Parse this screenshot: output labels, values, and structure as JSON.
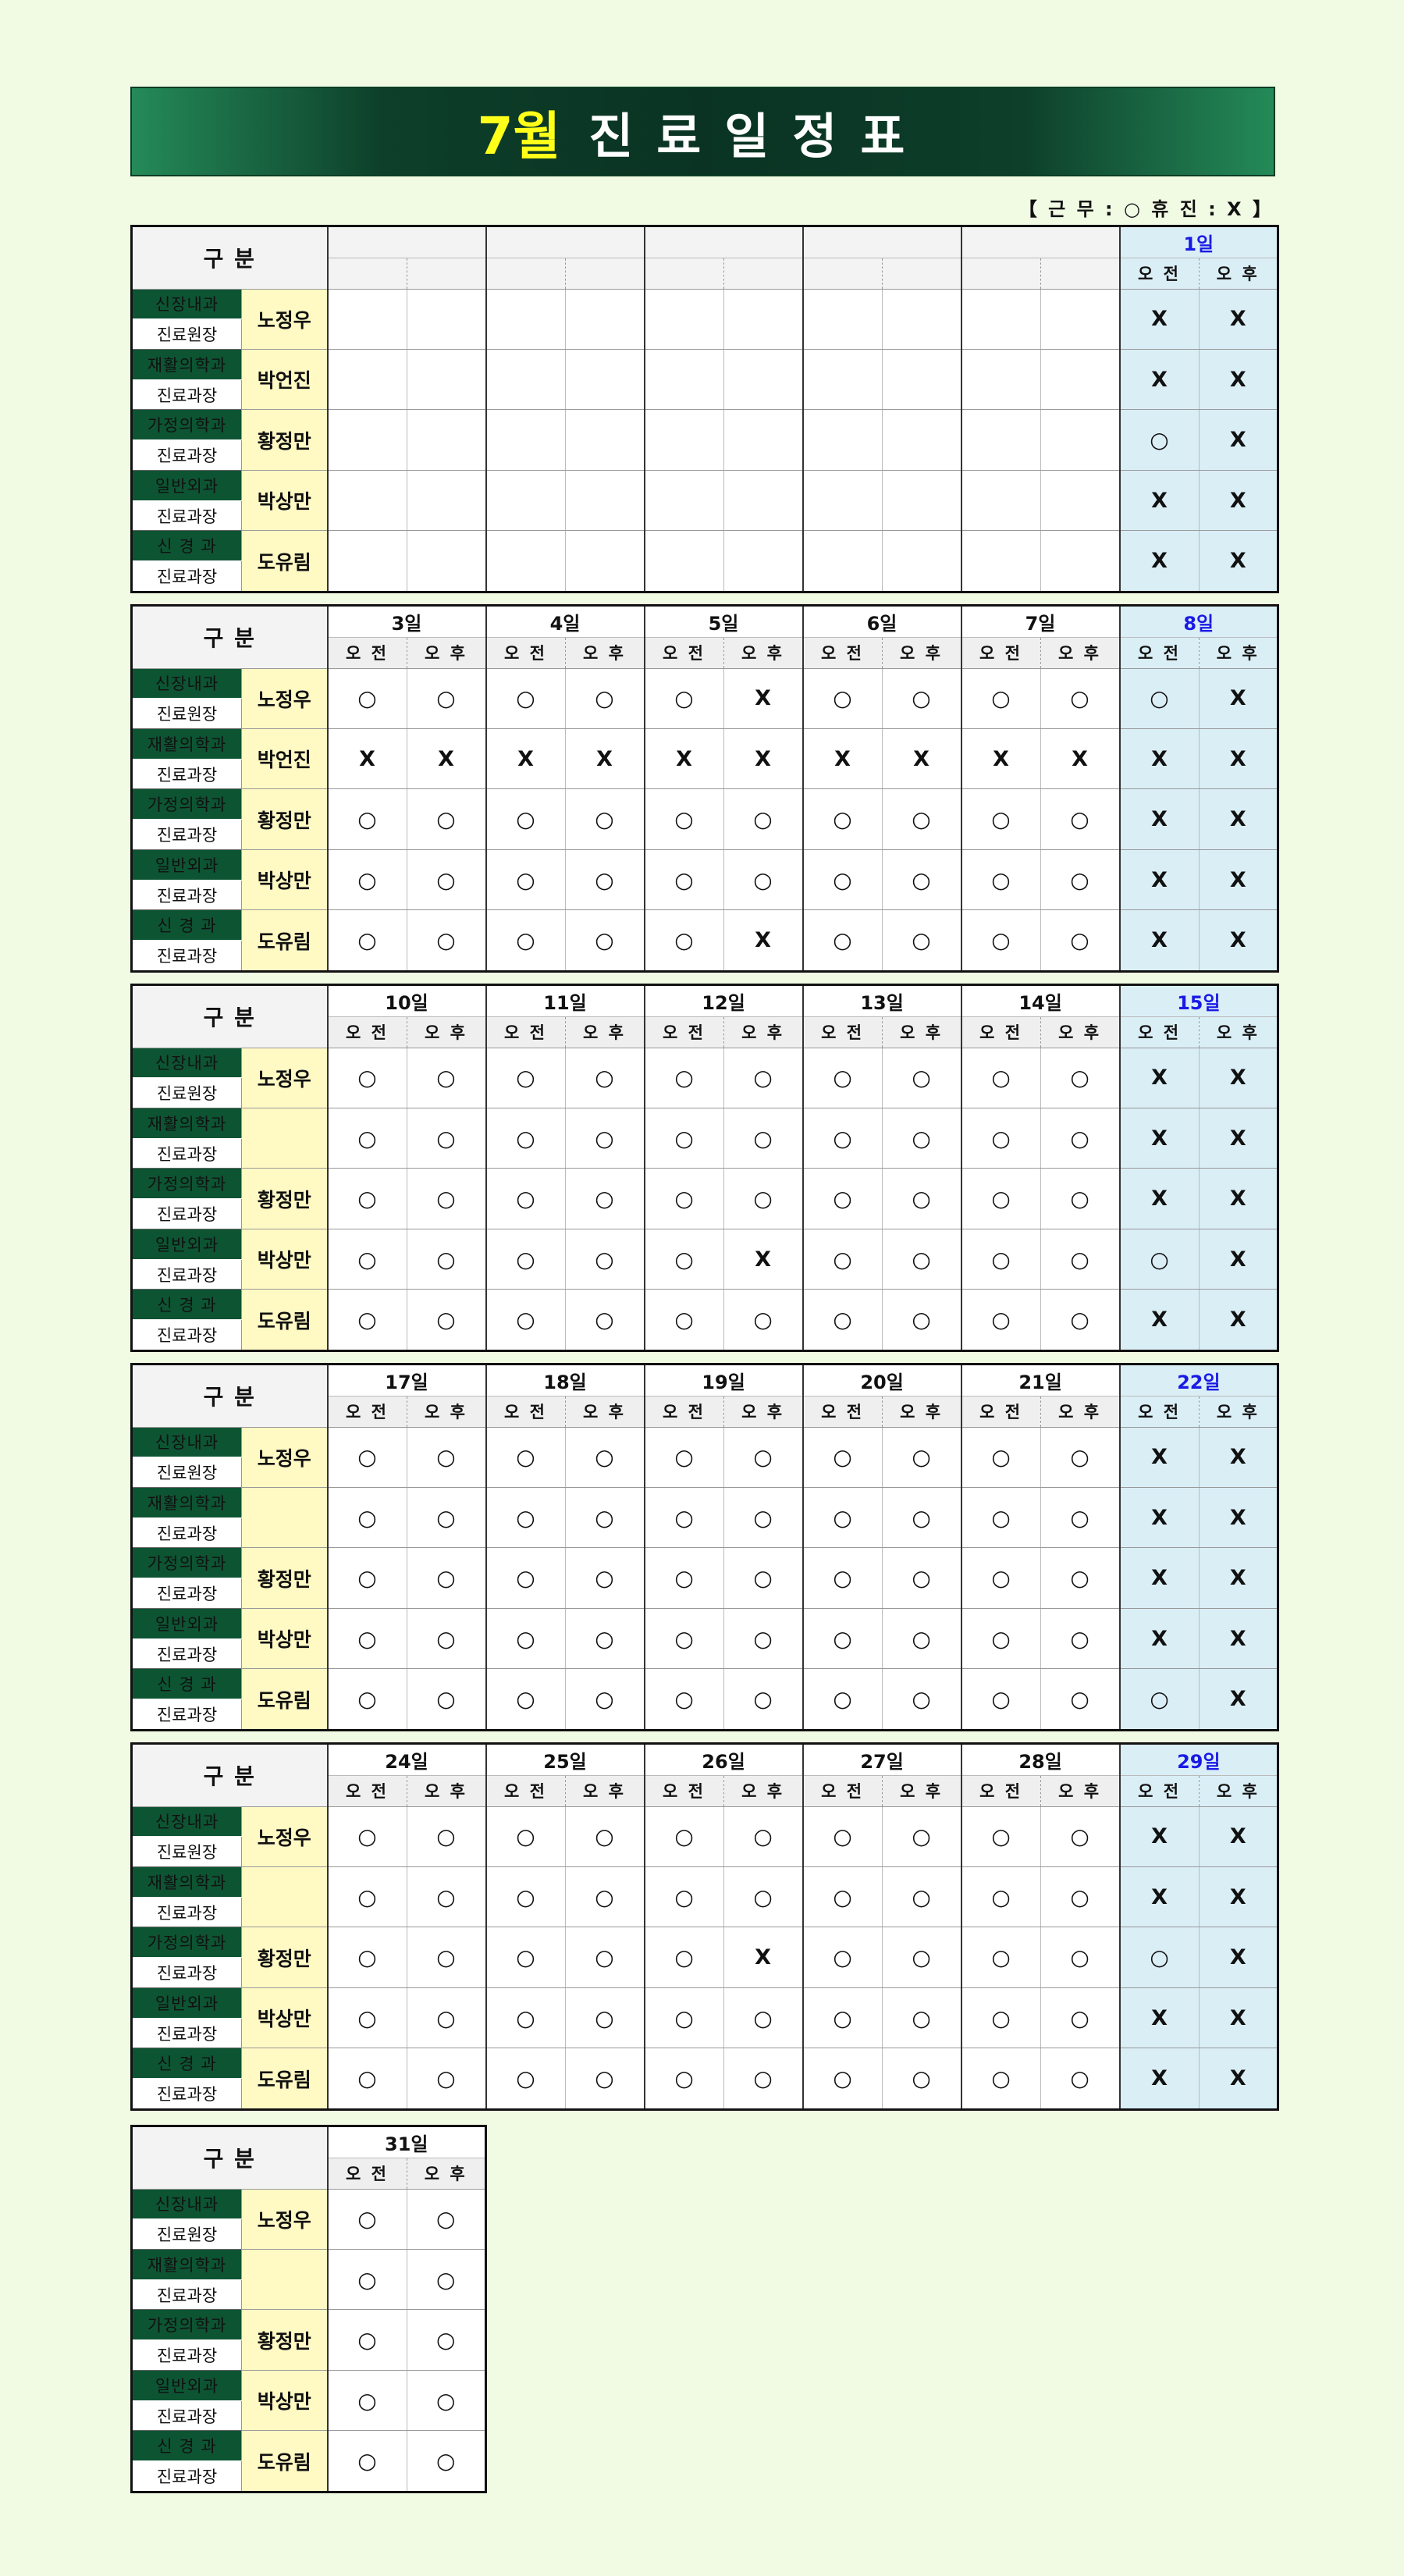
{
  "title": {
    "month": "7월",
    "rest": "진료일정표"
  },
  "legend": "【 근 무 : ○  휴 진 : X 】",
  "labels": {
    "gubun": "구    분",
    "am": "오 전",
    "pm": "오 후"
  },
  "rows": [
    {
      "dept": "신장내과",
      "title": "진료원장"
    },
    {
      "dept": "재활의학과",
      "title": "진료과장"
    },
    {
      "dept": "가정의학과",
      "title": "진료과장"
    },
    {
      "dept": "일반외과",
      "title": "진료과장"
    },
    {
      "dept": "신 경 과",
      "title": "진료과장"
    }
  ],
  "symbols": {
    "work": "○",
    "off": "X"
  },
  "colors": {
    "dept_bg": "#0d5433",
    "doctor_bg": "#fff9c4",
    "saturday_bg": "#daeef6",
    "saturday_text": "#1a1ae6",
    "title_month": "#ffff1a"
  },
  "weeks": [
    {
      "doctors": [
        "노정우",
        "박언진",
        "황정만",
        "박상만",
        "도유림"
      ],
      "days": [
        {
          "date": "",
          "schedule": null
        },
        {
          "date": "",
          "schedule": null
        },
        {
          "date": "",
          "schedule": null
        },
        {
          "date": "",
          "schedule": null
        },
        {
          "date": "",
          "schedule": null
        },
        {
          "date": "1일",
          "saturday": true,
          "schedule": [
            [
              "X",
              "X"
            ],
            [
              "X",
              "X"
            ],
            [
              "○",
              "X"
            ],
            [
              "X",
              "X"
            ],
            [
              "X",
              "X"
            ]
          ]
        }
      ]
    },
    {
      "doctors": [
        "노정우",
        "박언진",
        "황정만",
        "박상만",
        "도유림"
      ],
      "days": [
        {
          "date": "3일",
          "schedule": [
            [
              "○",
              "○"
            ],
            [
              "X",
              "X"
            ],
            [
              "○",
              "○"
            ],
            [
              "○",
              "○"
            ],
            [
              "○",
              "○"
            ]
          ]
        },
        {
          "date": "4일",
          "schedule": [
            [
              "○",
              "○"
            ],
            [
              "X",
              "X"
            ],
            [
              "○",
              "○"
            ],
            [
              "○",
              "○"
            ],
            [
              "○",
              "○"
            ]
          ]
        },
        {
          "date": "5일",
          "schedule": [
            [
              "○",
              "X"
            ],
            [
              "X",
              "X"
            ],
            [
              "○",
              "○"
            ],
            [
              "○",
              "○"
            ],
            [
              "○",
              "X"
            ]
          ]
        },
        {
          "date": "6일",
          "schedule": [
            [
              "○",
              "○"
            ],
            [
              "X",
              "X"
            ],
            [
              "○",
              "○"
            ],
            [
              "○",
              "○"
            ],
            [
              "○",
              "○"
            ]
          ]
        },
        {
          "date": "7일",
          "schedule": [
            [
              "○",
              "○"
            ],
            [
              "X",
              "X"
            ],
            [
              "○",
              "○"
            ],
            [
              "○",
              "○"
            ],
            [
              "○",
              "○"
            ]
          ]
        },
        {
          "date": "8일",
          "saturday": true,
          "schedule": [
            [
              "○",
              "X"
            ],
            [
              "X",
              "X"
            ],
            [
              "X",
              "X"
            ],
            [
              "X",
              "X"
            ],
            [
              "X",
              "X"
            ]
          ]
        }
      ]
    },
    {
      "doctors": [
        "노정우",
        "",
        "황정만",
        "박상만",
        "도유림"
      ],
      "days": [
        {
          "date": "10일",
          "schedule": [
            [
              "○",
              "○"
            ],
            [
              "○",
              "○"
            ],
            [
              "○",
              "○"
            ],
            [
              "○",
              "○"
            ],
            [
              "○",
              "○"
            ]
          ]
        },
        {
          "date": "11일",
          "schedule": [
            [
              "○",
              "○"
            ],
            [
              "○",
              "○"
            ],
            [
              "○",
              "○"
            ],
            [
              "○",
              "○"
            ],
            [
              "○",
              "○"
            ]
          ]
        },
        {
          "date": "12일",
          "schedule": [
            [
              "○",
              "○"
            ],
            [
              "○",
              "○"
            ],
            [
              "○",
              "○"
            ],
            [
              "○",
              "X"
            ],
            [
              "○",
              "○"
            ]
          ]
        },
        {
          "date": "13일",
          "schedule": [
            [
              "○",
              "○"
            ],
            [
              "○",
              "○"
            ],
            [
              "○",
              "○"
            ],
            [
              "○",
              "○"
            ],
            [
              "○",
              "○"
            ]
          ]
        },
        {
          "date": "14일",
          "schedule": [
            [
              "○",
              "○"
            ],
            [
              "○",
              "○"
            ],
            [
              "○",
              "○"
            ],
            [
              "○",
              "○"
            ],
            [
              "○",
              "○"
            ]
          ]
        },
        {
          "date": "15일",
          "saturday": true,
          "schedule": [
            [
              "X",
              "X"
            ],
            [
              "X",
              "X"
            ],
            [
              "X",
              "X"
            ],
            [
              "○",
              "X"
            ],
            [
              "X",
              "X"
            ]
          ]
        }
      ]
    },
    {
      "doctors": [
        "노정우",
        "",
        "황정만",
        "박상만",
        "도유림"
      ],
      "days": [
        {
          "date": "17일",
          "schedule": [
            [
              "○",
              "○"
            ],
            [
              "○",
              "○"
            ],
            [
              "○",
              "○"
            ],
            [
              "○",
              "○"
            ],
            [
              "○",
              "○"
            ]
          ]
        },
        {
          "date": "18일",
          "schedule": [
            [
              "○",
              "○"
            ],
            [
              "○",
              "○"
            ],
            [
              "○",
              "○"
            ],
            [
              "○",
              "○"
            ],
            [
              "○",
              "○"
            ]
          ]
        },
        {
          "date": "19일",
          "schedule": [
            [
              "○",
              "○"
            ],
            [
              "○",
              "○"
            ],
            [
              "○",
              "○"
            ],
            [
              "○",
              "○"
            ],
            [
              "○",
              "○"
            ]
          ]
        },
        {
          "date": "20일",
          "schedule": [
            [
              "○",
              "○"
            ],
            [
              "○",
              "○"
            ],
            [
              "○",
              "○"
            ],
            [
              "○",
              "○"
            ],
            [
              "○",
              "○"
            ]
          ]
        },
        {
          "date": "21일",
          "schedule": [
            [
              "○",
              "○"
            ],
            [
              "○",
              "○"
            ],
            [
              "○",
              "○"
            ],
            [
              "○",
              "○"
            ],
            [
              "○",
              "○"
            ]
          ]
        },
        {
          "date": "22일",
          "saturday": true,
          "schedule": [
            [
              "X",
              "X"
            ],
            [
              "X",
              "X"
            ],
            [
              "X",
              "X"
            ],
            [
              "X",
              "X"
            ],
            [
              "○",
              "X"
            ]
          ]
        }
      ]
    },
    {
      "doctors": [
        "노정우",
        "",
        "황정만",
        "박상만",
        "도유림"
      ],
      "days": [
        {
          "date": "24일",
          "schedule": [
            [
              "○",
              "○"
            ],
            [
              "○",
              "○"
            ],
            [
              "○",
              "○"
            ],
            [
              "○",
              "○"
            ],
            [
              "○",
              "○"
            ]
          ]
        },
        {
          "date": "25일",
          "schedule": [
            [
              "○",
              "○"
            ],
            [
              "○",
              "○"
            ],
            [
              "○",
              "○"
            ],
            [
              "○",
              "○"
            ],
            [
              "○",
              "○"
            ]
          ]
        },
        {
          "date": "26일",
          "schedule": [
            [
              "○",
              "○"
            ],
            [
              "○",
              "○"
            ],
            [
              "○",
              "X"
            ],
            [
              "○",
              "○"
            ],
            [
              "○",
              "○"
            ]
          ]
        },
        {
          "date": "27일",
          "schedule": [
            [
              "○",
              "○"
            ],
            [
              "○",
              "○"
            ],
            [
              "○",
              "○"
            ],
            [
              "○",
              "○"
            ],
            [
              "○",
              "○"
            ]
          ]
        },
        {
          "date": "28일",
          "schedule": [
            [
              "○",
              "○"
            ],
            [
              "○",
              "○"
            ],
            [
              "○",
              "○"
            ],
            [
              "○",
              "○"
            ],
            [
              "○",
              "○"
            ]
          ]
        },
        {
          "date": "29일",
          "saturday": true,
          "schedule": [
            [
              "X",
              "X"
            ],
            [
              "X",
              "X"
            ],
            [
              "○",
              "X"
            ],
            [
              "X",
              "X"
            ],
            [
              "X",
              "X"
            ]
          ]
        }
      ]
    },
    {
      "doctors": [
        "노정우",
        "",
        "황정만",
        "박상만",
        "도유림"
      ],
      "days": [
        {
          "date": "31일",
          "schedule": [
            [
              "○",
              "○"
            ],
            [
              "○",
              "○"
            ],
            [
              "○",
              "○"
            ],
            [
              "○",
              "○"
            ],
            [
              "○",
              "○"
            ]
          ]
        }
      ]
    }
  ]
}
